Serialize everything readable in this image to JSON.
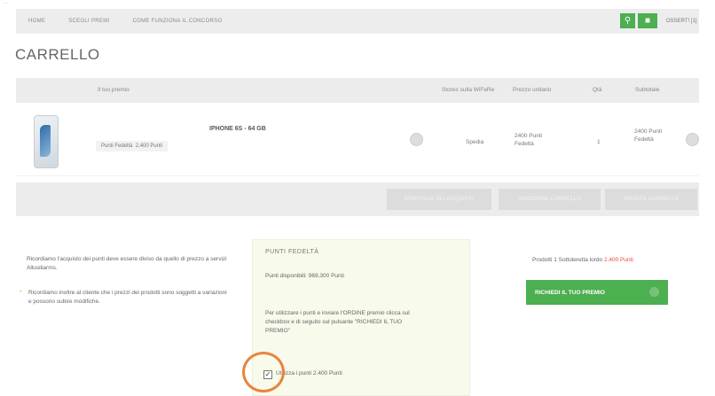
{
  "tiny_text": "...",
  "nav": {
    "items": [
      "HOME",
      "SCEGLI PREMI",
      "COME FUNZIONA IL CONCORSO"
    ]
  },
  "header": {
    "search_icon": "search-icon",
    "cart_icon": "cart-icon",
    "user_label": "OSSERT! [1]"
  },
  "page_title": "CARRELLO",
  "table": {
    "headers": [
      "Il tuo premio",
      "Stores sulla WiFeRe",
      "Prezzo unitario",
      "Qtà",
      "Subtotale"
    ],
    "row": {
      "product_name": "IPHONE 6S - 64 GB",
      "points_label": "Punti Fedeltà",
      "points_value": "2.400 Punti",
      "shipping": "Spedia",
      "unit_price": "2400 Punti Fedeltà",
      "qty": "1",
      "subtotal": "2400 Punti Fedeltà"
    }
  },
  "actions": [
    "CONTINUA GLI ACQUISTI",
    "AGGIORNA CARRELLO",
    "SVUOTA CARRELLO"
  ],
  "notes": [
    "Ricordiamo l'acquisto dei punti deve essere diviso da quello di prezzo a servizi Allusiliarms.",
    "Ricordiamo inoltre al cliente che i prezzi dei prodotti sono soggetti a variazioni e possono subire modifiche."
  ],
  "points_panel": {
    "title": "PUNTI FEDELTÀ",
    "available": "Punti disponibili: 969,300 Punti",
    "instruction": "Per utilizzare i punti e inviare l'ORDINE premio clicca sul checkbox e di seguito sul pulsante \"RICHIEDI IL TUO PREMIO\"",
    "checkbox_label": "Utilizza i punti 2.400 Punti",
    "checkbox_checked": true
  },
  "summary": {
    "total_label": "Prodotti 1 Sottoleretta lordo",
    "total_value": "2.400 Punti",
    "request_button": "RICHIEDI IL TUO PREMIO"
  }
}
